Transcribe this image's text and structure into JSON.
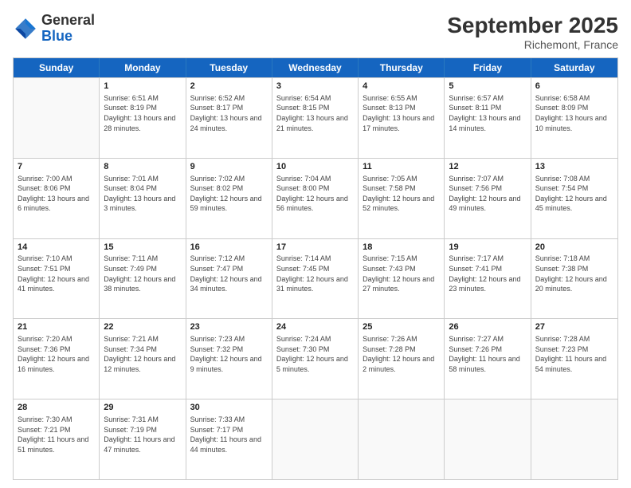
{
  "logo": {
    "general": "General",
    "blue": "Blue"
  },
  "title": "September 2025",
  "subtitle": "Richemont, France",
  "header_days": [
    "Sunday",
    "Monday",
    "Tuesday",
    "Wednesday",
    "Thursday",
    "Friday",
    "Saturday"
  ],
  "weeks": [
    [
      {
        "day": "",
        "info": ""
      },
      {
        "day": "1",
        "info": "Sunrise: 6:51 AM\nSunset: 8:19 PM\nDaylight: 13 hours and 28 minutes."
      },
      {
        "day": "2",
        "info": "Sunrise: 6:52 AM\nSunset: 8:17 PM\nDaylight: 13 hours and 24 minutes."
      },
      {
        "day": "3",
        "info": "Sunrise: 6:54 AM\nSunset: 8:15 PM\nDaylight: 13 hours and 21 minutes."
      },
      {
        "day": "4",
        "info": "Sunrise: 6:55 AM\nSunset: 8:13 PM\nDaylight: 13 hours and 17 minutes."
      },
      {
        "day": "5",
        "info": "Sunrise: 6:57 AM\nSunset: 8:11 PM\nDaylight: 13 hours and 14 minutes."
      },
      {
        "day": "6",
        "info": "Sunrise: 6:58 AM\nSunset: 8:09 PM\nDaylight: 13 hours and 10 minutes."
      }
    ],
    [
      {
        "day": "7",
        "info": "Sunrise: 7:00 AM\nSunset: 8:06 PM\nDaylight: 13 hours and 6 minutes."
      },
      {
        "day": "8",
        "info": "Sunrise: 7:01 AM\nSunset: 8:04 PM\nDaylight: 13 hours and 3 minutes."
      },
      {
        "day": "9",
        "info": "Sunrise: 7:02 AM\nSunset: 8:02 PM\nDaylight: 12 hours and 59 minutes."
      },
      {
        "day": "10",
        "info": "Sunrise: 7:04 AM\nSunset: 8:00 PM\nDaylight: 12 hours and 56 minutes."
      },
      {
        "day": "11",
        "info": "Sunrise: 7:05 AM\nSunset: 7:58 PM\nDaylight: 12 hours and 52 minutes."
      },
      {
        "day": "12",
        "info": "Sunrise: 7:07 AM\nSunset: 7:56 PM\nDaylight: 12 hours and 49 minutes."
      },
      {
        "day": "13",
        "info": "Sunrise: 7:08 AM\nSunset: 7:54 PM\nDaylight: 12 hours and 45 minutes."
      }
    ],
    [
      {
        "day": "14",
        "info": "Sunrise: 7:10 AM\nSunset: 7:51 PM\nDaylight: 12 hours and 41 minutes."
      },
      {
        "day": "15",
        "info": "Sunrise: 7:11 AM\nSunset: 7:49 PM\nDaylight: 12 hours and 38 minutes."
      },
      {
        "day": "16",
        "info": "Sunrise: 7:12 AM\nSunset: 7:47 PM\nDaylight: 12 hours and 34 minutes."
      },
      {
        "day": "17",
        "info": "Sunrise: 7:14 AM\nSunset: 7:45 PM\nDaylight: 12 hours and 31 minutes."
      },
      {
        "day": "18",
        "info": "Sunrise: 7:15 AM\nSunset: 7:43 PM\nDaylight: 12 hours and 27 minutes."
      },
      {
        "day": "19",
        "info": "Sunrise: 7:17 AM\nSunset: 7:41 PM\nDaylight: 12 hours and 23 minutes."
      },
      {
        "day": "20",
        "info": "Sunrise: 7:18 AM\nSunset: 7:38 PM\nDaylight: 12 hours and 20 minutes."
      }
    ],
    [
      {
        "day": "21",
        "info": "Sunrise: 7:20 AM\nSunset: 7:36 PM\nDaylight: 12 hours and 16 minutes."
      },
      {
        "day": "22",
        "info": "Sunrise: 7:21 AM\nSunset: 7:34 PM\nDaylight: 12 hours and 12 minutes."
      },
      {
        "day": "23",
        "info": "Sunrise: 7:23 AM\nSunset: 7:32 PM\nDaylight: 12 hours and 9 minutes."
      },
      {
        "day": "24",
        "info": "Sunrise: 7:24 AM\nSunset: 7:30 PM\nDaylight: 12 hours and 5 minutes."
      },
      {
        "day": "25",
        "info": "Sunrise: 7:26 AM\nSunset: 7:28 PM\nDaylight: 12 hours and 2 minutes."
      },
      {
        "day": "26",
        "info": "Sunrise: 7:27 AM\nSunset: 7:26 PM\nDaylight: 11 hours and 58 minutes."
      },
      {
        "day": "27",
        "info": "Sunrise: 7:28 AM\nSunset: 7:23 PM\nDaylight: 11 hours and 54 minutes."
      }
    ],
    [
      {
        "day": "28",
        "info": "Sunrise: 7:30 AM\nSunset: 7:21 PM\nDaylight: 11 hours and 51 minutes."
      },
      {
        "day": "29",
        "info": "Sunrise: 7:31 AM\nSunset: 7:19 PM\nDaylight: 11 hours and 47 minutes."
      },
      {
        "day": "30",
        "info": "Sunrise: 7:33 AM\nSunset: 7:17 PM\nDaylight: 11 hours and 44 minutes."
      },
      {
        "day": "",
        "info": ""
      },
      {
        "day": "",
        "info": ""
      },
      {
        "day": "",
        "info": ""
      },
      {
        "day": "",
        "info": ""
      }
    ]
  ]
}
